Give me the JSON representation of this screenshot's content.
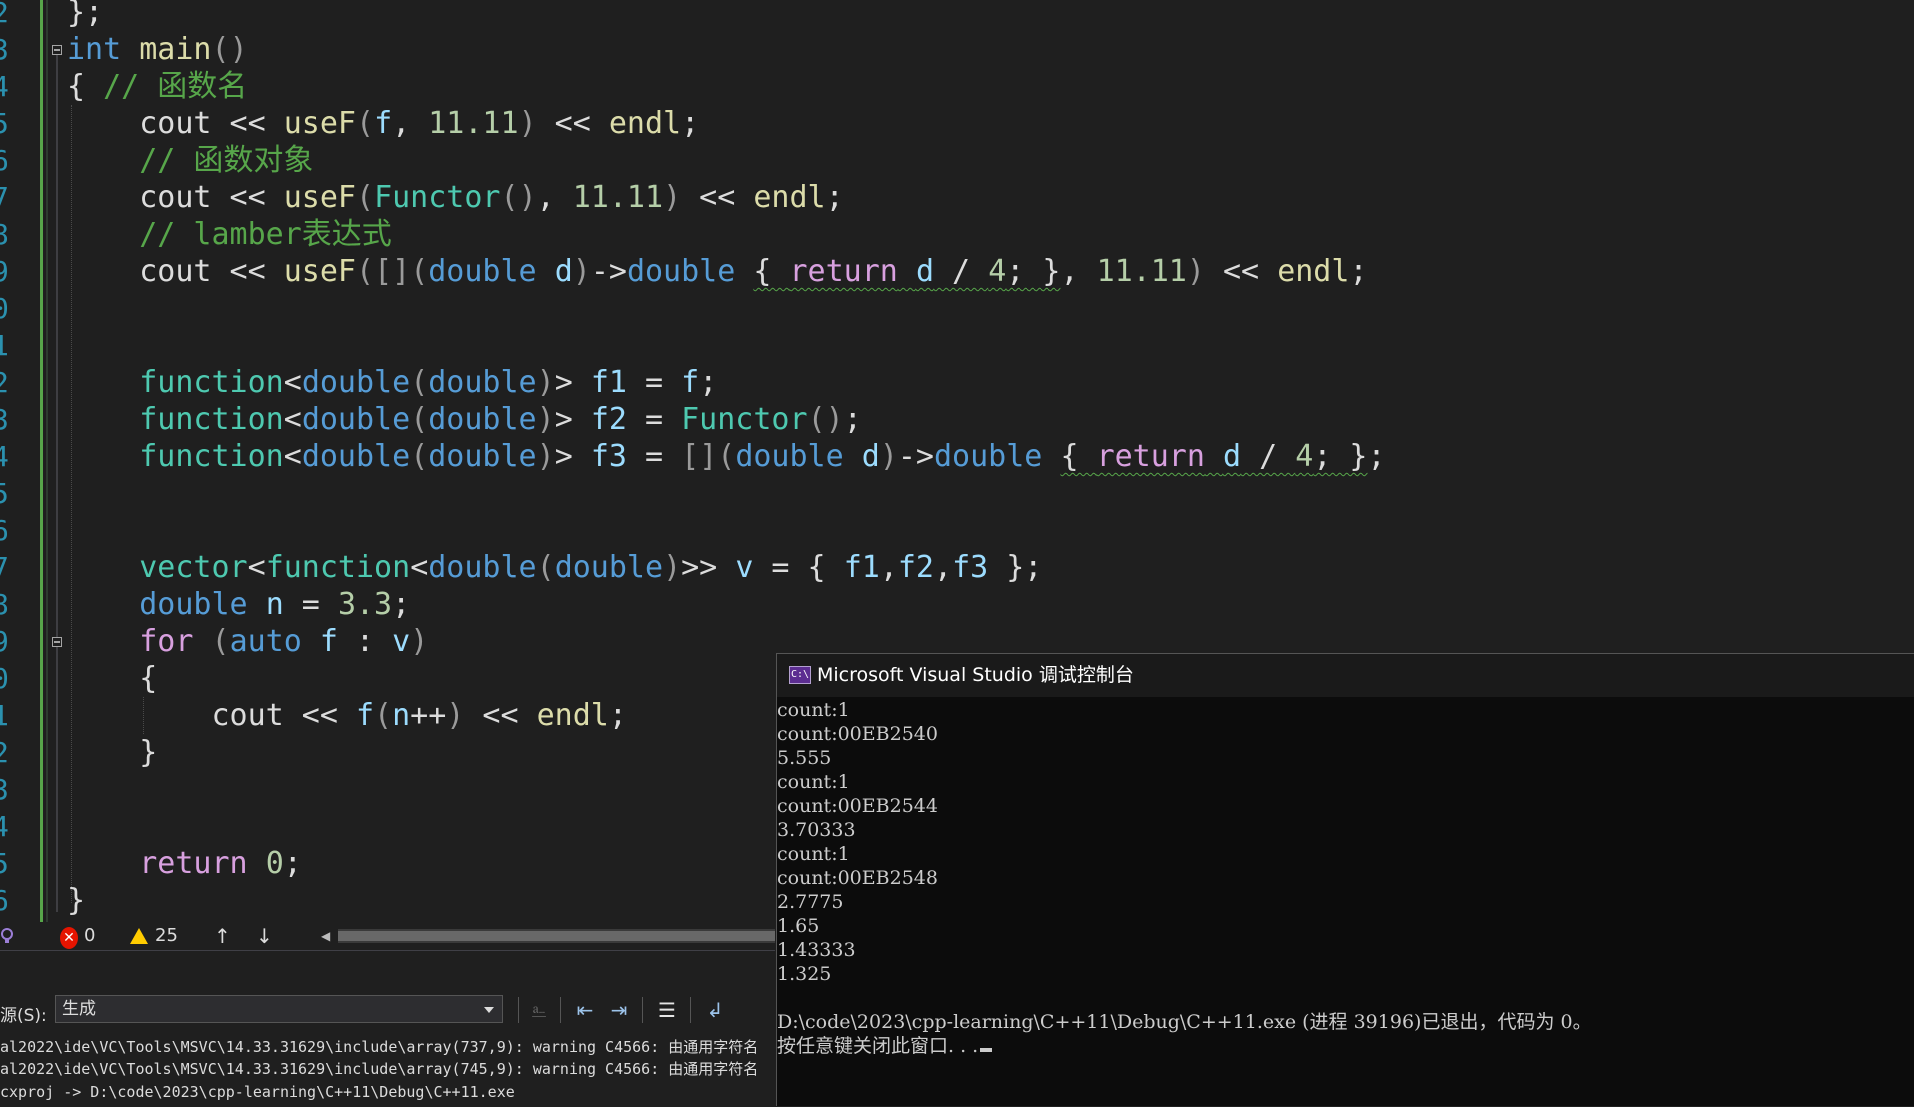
{
  "editor": {
    "line_numbers": [
      "2",
      "3",
      "4",
      "5",
      "6",
      "7",
      "8",
      "9",
      "0",
      "1",
      "2",
      "3",
      "4",
      "5",
      "6",
      "7",
      "8",
      "9",
      "0",
      "1",
      "2",
      "3",
      "4",
      "5",
      "6"
    ],
    "lines": [
      "};",
      "int main()",
      "{ // 函数名",
      "    cout << useF(f, 11.11) << endl;",
      "    // 函数对象",
      "    cout << useF(Functor(), 11.11) << endl;",
      "    // lamber表达式",
      "    cout << useF([](double d)->double { return d / 4; }, 11.11) << endl;",
      "",
      "",
      "    function<double(double)> f1 = f;",
      "    function<double(double)> f2 = Functor();",
      "    function<double(double)> f3 = [](double d)->double { return d / 4; };",
      "",
      "",
      "    vector<function<double(double)>> v = { f1,f2,f3 };",
      "    double n = 3.3;",
      "    for (auto f : v)",
      "    {",
      "        cout << f(n++) << endl;",
      "    }",
      "",
      "",
      "    return 0;",
      "}"
    ]
  },
  "status": {
    "errors": "0",
    "warnings": "25",
    "up_arrow": "↑",
    "down_arrow": "↓",
    "scroll_left": "◀"
  },
  "output": {
    "source_label": "源(S):",
    "source_value": "生成",
    "lines": [
      "al2022\\ide\\VC\\Tools\\MSVC\\14.33.31629\\include\\array(737,9): warning C4566: 由通用字符名",
      "al2022\\ide\\VC\\Tools\\MSVC\\14.33.31629\\include\\array(745,9): warning C4566: 由通用字符名",
      "cxproj -> D:\\code\\2023\\cpp-learning\\C++11\\Debug\\C++11.exe"
    ]
  },
  "console": {
    "title": "Microsoft Visual Studio 调试控制台",
    "icon_text": "C:\\",
    "lines": [
      "count:1",
      "count:00EB2540",
      "5.555",
      "count:1",
      "count:00EB2544",
      "3.70333",
      "count:1",
      "count:00EB2548",
      "2.7775",
      "1.65",
      "1.43333",
      "1.325",
      "",
      "D:\\code\\2023\\cpp-learning\\C++11\\Debug\\C++11.exe (进程 39196)已退出，代码为 0。",
      "按任意键关闭此窗口. . ."
    ]
  }
}
